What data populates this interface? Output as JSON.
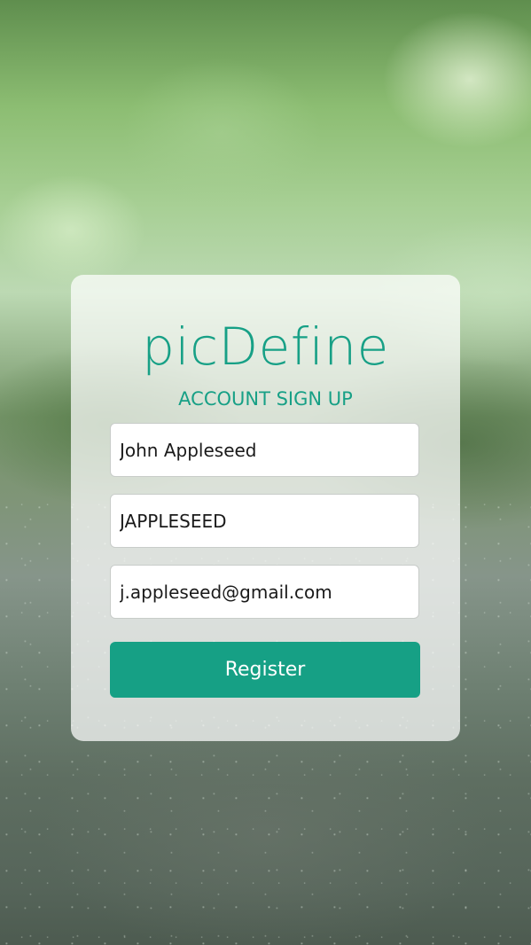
{
  "app": {
    "title": "picDefine",
    "subtitle": "ACCOUNT SIGN UP"
  },
  "form": {
    "full_name": {
      "value": "John Appleseed"
    },
    "username": {
      "value": "JAPPLESEED"
    },
    "email": {
      "value": "j.appleseed@gmail.com"
    },
    "register_label": "Register"
  },
  "colors": {
    "accent": "#16a085",
    "card": "#ffffff"
  }
}
